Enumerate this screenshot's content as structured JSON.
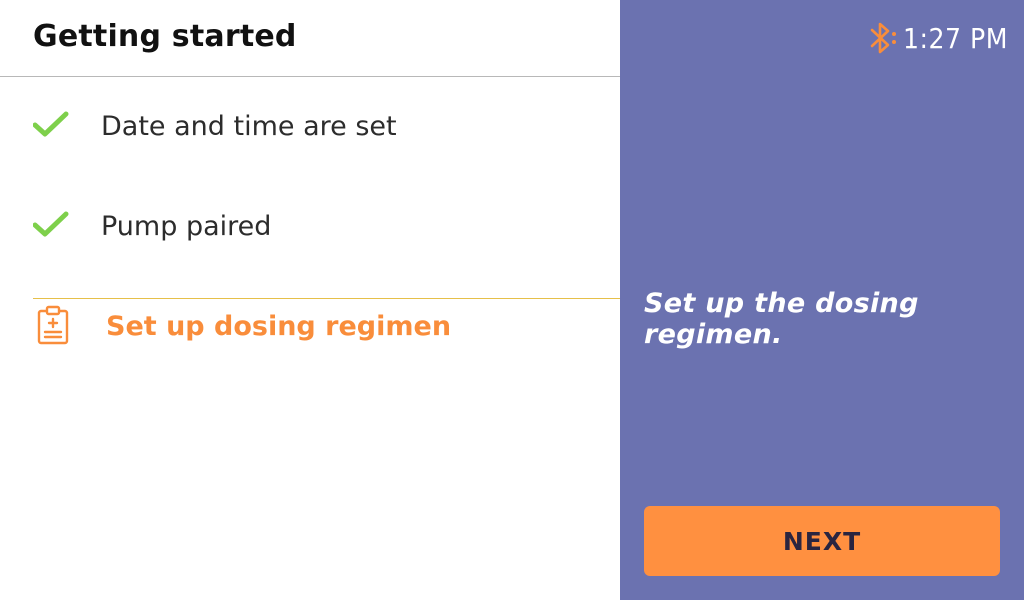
{
  "header": {
    "title": "Getting started"
  },
  "status_bar": {
    "bluetooth_icon": "bluetooth-icon",
    "time": "1:27 PM"
  },
  "steps": [
    {
      "label": "Date and time are set",
      "status": "complete",
      "icon": "check-icon"
    },
    {
      "label": "Pump paired",
      "status": "complete",
      "icon": "check-icon"
    },
    {
      "label": "Set up dosing regimen",
      "status": "active",
      "icon": "clipboard-icon"
    }
  ],
  "side_panel": {
    "hint": "Set up the dosing regimen.",
    "next_label": "NEXT"
  },
  "colors": {
    "panel": "#6b72b0",
    "accent": "#f98d3b",
    "check": "#7ed04b",
    "button": "#ff9040"
  }
}
